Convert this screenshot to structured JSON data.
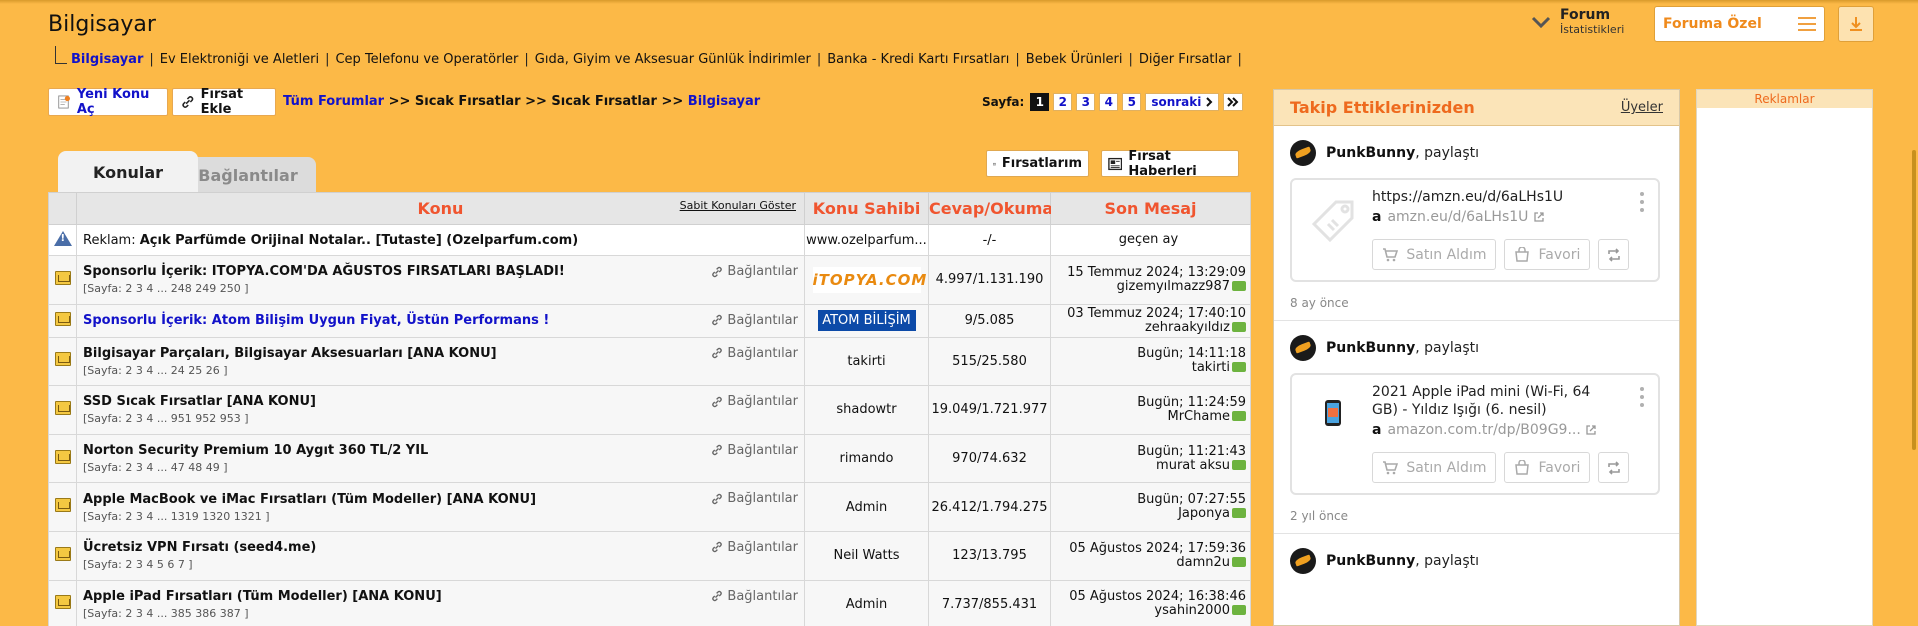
{
  "header": {
    "title": "Bilgisayar",
    "forum_stats_line1": "Forum",
    "forum_stats_line2": "İstatistikleri",
    "special_label": "Foruma Özel"
  },
  "subcategories": [
    "Bilgisayar",
    "Ev Elektroniği ve Aletleri",
    "Cep Telefonu ve Operatörler",
    "Gıda, Giyim ve Aksesuar Günlük İndirimler",
    "Banka - Kredi Kartı Fırsatları",
    "Bebek Ürünleri",
    "Diğer Fırsatlar"
  ],
  "toolbar": {
    "new_topic": "Yeni Konu Aç",
    "add_deal": "Fırsat Ekle",
    "breadcrumb_all": "Tüm Forumlar",
    "breadcrumb_1": ">> Sıcak Fırsatlar",
    "breadcrumb_2": ">> Sıcak Fırsatlar >>",
    "breadcrumb_current": "Bilgisayar",
    "page_label": "Sayfa:",
    "pages": [
      "1",
      "2",
      "3",
      "4",
      "5"
    ],
    "next": "sonraki"
  },
  "tabs": {
    "topics": "Konular",
    "links": "Bağlantılar",
    "my_deals": "Fırsatlarım",
    "deal_news": "Fırsat Haberleri"
  },
  "table": {
    "headers": {
      "topic": "Konu",
      "sticky": "Sabit Konuları Göster",
      "owner": "Konu Sahibi",
      "replies": "Cevap/Okuma",
      "last": "Son Mesaj"
    },
    "ad": {
      "prefix": "Reklam:",
      "title": "Açık Parfümde Orijinal Notalar.. [Tutaste] (Ozelparfum.com)",
      "owner": "www.ozelparfum...",
      "count": "-/-",
      "last": "geçen ay"
    },
    "links_label": "Bağlantılar",
    "rows": [
      {
        "title": "Sponsorlu İçerik: ITOPYA.COM'DA AĞUSTOS FIRSATLARI BAŞLADI!",
        "pages": "[Sayfa: 2 3 4 ... 248 249 250 ]",
        "owner": "iTOPYA.COM",
        "count": "4.997/1.131.190",
        "date": "15 Temmuz 2024; 13:29:09",
        "user": "gizemyılmazz987"
      },
      {
        "title": "Sponsorlu İçerik: Atom Bilişim Uygun Fiyat, Üstün Performans !",
        "pages": "",
        "owner": "ATOM BİLİŞİM",
        "count": "9/5.085",
        "date": "03 Temmuz 2024; 17:40:10",
        "user": "zehraakyıldız"
      },
      {
        "title": "Bilgisayar Parçaları, Bilgisayar Aksesuarları [ANA KONU]",
        "pages": "[Sayfa: 2 3 4 ... 24 25 26 ]",
        "owner": "takirti",
        "count": "515/25.580",
        "date": "Bugün; 14:11:18",
        "user": "takirti"
      },
      {
        "title": "SSD Sıcak Fırsatlar [ANA KONU]",
        "pages": "[Sayfa: 2 3 4 ... 951 952 953 ]",
        "owner": "shadowtr",
        "count": "19.049/1.721.977",
        "date": "Bugün; 11:24:59",
        "user": "MrChame"
      },
      {
        "title": "Norton Security Premium 10 Aygıt 360 TL/2 YIL",
        "pages": "[Sayfa: 2 3 4 ... 47 48 49 ]",
        "owner": "rimando",
        "count": "970/74.632",
        "date": "Bugün; 11:21:43",
        "user": "murat aksu"
      },
      {
        "title": "Apple MacBook ve iMac Fırsatları (Tüm Modeller) [ANA KONU]",
        "pages": "[Sayfa: 2 3 4 ... 1319 1320 1321 ]",
        "owner": "Admin",
        "count": "26.412/1.794.275",
        "date": "Bugün; 07:27:55",
        "user": "Japonya"
      },
      {
        "title": "Ücretsiz VPN Fırsatı (seed4.me)",
        "pages": "[Sayfa: 2 3 4 5 6 7 ]",
        "owner": "Neil Watts",
        "count": "123/13.795",
        "date": "05 Ağustos 2024; 17:59:36",
        "user": "damn2u"
      },
      {
        "title": "Apple iPad Fırsatları (Tüm Modeller) [ANA KONU]",
        "pages": "[Sayfa: 2 3 4 ... 385 386 387 ]",
        "owner": "Admin",
        "count": "7.737/855.431",
        "date": "05 Ağustos 2024; 16:38:46",
        "user": "ysahin2000"
      }
    ]
  },
  "follow": {
    "title": "Takip Ettiklerinizden",
    "users_link": "Üyeler",
    "posts": [
      {
        "user": "PunkBunny",
        "action": ", paylaştı",
        "url": "https://amzn.eu/d/6aLHs1U",
        "domain": "amzn.eu/d/6aLHs1U",
        "buy": "Satın Aldım",
        "fav": "Favori",
        "ago": "8 ay önce"
      },
      {
        "user": "PunkBunny",
        "action": ", paylaştı",
        "url": "2021 Apple iPad mini (Wi-Fi, 64 GB) - Yıldız Işığı (6. nesil)",
        "domain": "amazon.com.tr/dp/B09G9...",
        "buy": "Satın Aldım",
        "fav": "Favori",
        "ago": "2 yıl önce"
      },
      {
        "user": "PunkBunny",
        "action": ", paylaştı"
      }
    ]
  },
  "ads": {
    "label": "Reklamlar"
  },
  "colors": {
    "background": "#fcb947",
    "accent_orange": "#f0552f",
    "link_blue": "#1212c9"
  }
}
